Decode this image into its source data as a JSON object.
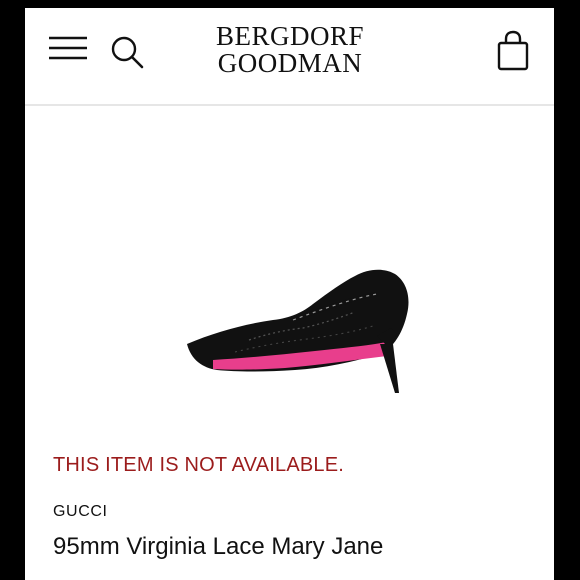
{
  "header": {
    "logo_line1": "BERGDORF",
    "logo_line2": "GOODMAN"
  },
  "product": {
    "availability_message": "THIS ITEM IS NOT AVAILABLE.",
    "brand": "GUCCI",
    "name": "95mm Virginia Lace Mary Jane"
  },
  "icons": {
    "menu": "hamburger-menu-icon",
    "search": "search-icon",
    "bag": "shopping-bag-icon"
  },
  "colors": {
    "availability_text": "#9b1c1c",
    "sole": "#e83e8c",
    "shoe": "#111111"
  }
}
